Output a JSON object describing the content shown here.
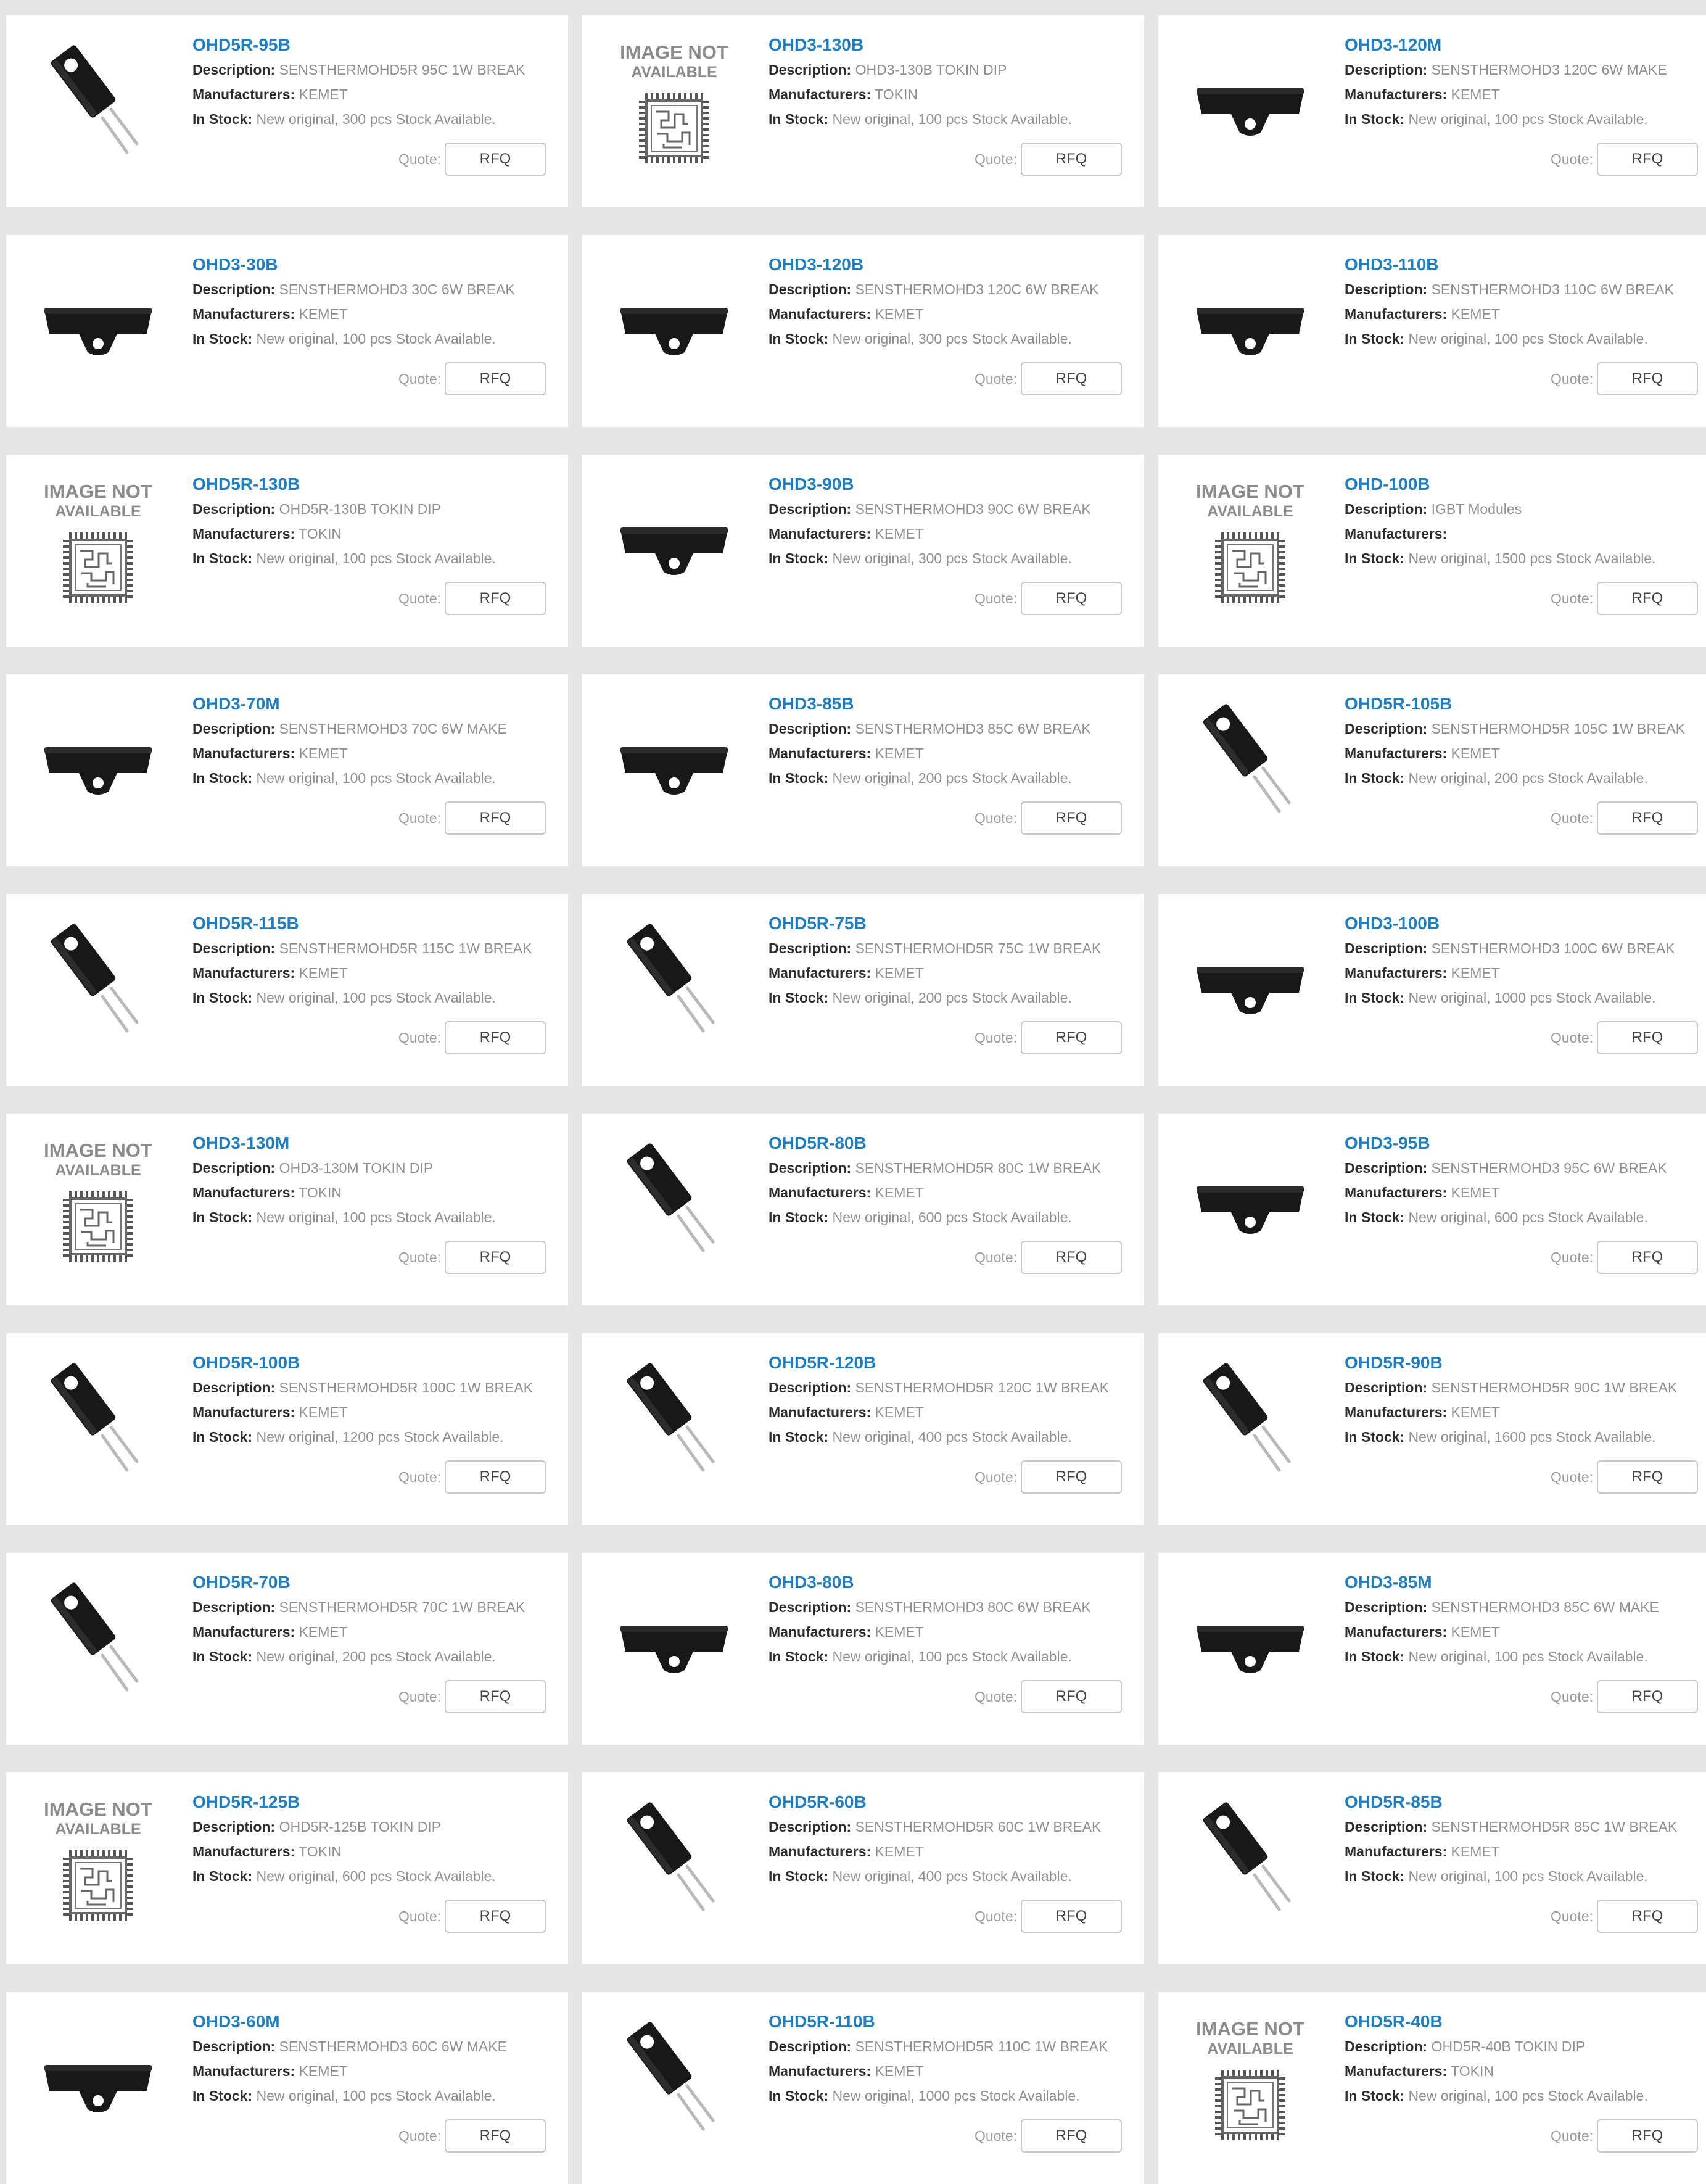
{
  "labels": {
    "description": "Description:",
    "manufacturers": "Manufacturers:",
    "in_stock": "In Stock:",
    "quote": "Quote:",
    "rfq": "RFQ",
    "na_line1": "IMAGE NOT",
    "na_line2": "AVAILABLE"
  },
  "products": [
    {
      "pn": "OHD5R-95B",
      "desc": "SENSTHERMOHD5R 95C 1W BREAK",
      "mfr": "KEMET",
      "stock": "New original, 300 pcs Stock Available.",
      "img": "tall"
    },
    {
      "pn": "OHD3-130B",
      "desc": "OHD3-130B TOKIN DIP",
      "mfr": "TOKIN",
      "stock": "New original, 100 pcs Stock Available.",
      "img": "na"
    },
    {
      "pn": "OHD3-120M",
      "desc": "SENSTHERMOHD3 120C 6W MAKE",
      "mfr": "KEMET",
      "stock": "New original, 100 pcs Stock Available.",
      "img": "flat"
    },
    {
      "pn": "OHD3-30B",
      "desc": "SENSTHERMOHD3 30C 6W BREAK",
      "mfr": "KEMET",
      "stock": "New original, 100 pcs Stock Available.",
      "img": "flat"
    },
    {
      "pn": "OHD3-120B",
      "desc": "SENSTHERMOHD3 120C 6W BREAK",
      "mfr": "KEMET",
      "stock": "New original, 300 pcs Stock Available.",
      "img": "flat"
    },
    {
      "pn": "OHD3-110B",
      "desc": "SENSTHERMOHD3 110C 6W BREAK",
      "mfr": "KEMET",
      "stock": "New original, 100 pcs Stock Available.",
      "img": "flat"
    },
    {
      "pn": "OHD5R-130B",
      "desc": "OHD5R-130B TOKIN DIP",
      "mfr": "TOKIN",
      "stock": "New original, 100 pcs Stock Available.",
      "img": "na"
    },
    {
      "pn": "OHD3-90B",
      "desc": "SENSTHERMOHD3 90C 6W BREAK",
      "mfr": "KEMET",
      "stock": "New original, 300 pcs Stock Available.",
      "img": "flat"
    },
    {
      "pn": "OHD-100B",
      "desc": "IGBT Modules",
      "mfr": "",
      "stock": "New original, 1500 pcs Stock Available.",
      "img": "na"
    },
    {
      "pn": "OHD3-70M",
      "desc": "SENSTHERMOHD3 70C 6W MAKE",
      "mfr": "KEMET",
      "stock": "New original, 100 pcs Stock Available.",
      "img": "flat"
    },
    {
      "pn": "OHD3-85B",
      "desc": "SENSTHERMOHD3 85C 6W BREAK",
      "mfr": "KEMET",
      "stock": "New original, 200 pcs Stock Available.",
      "img": "flat"
    },
    {
      "pn": "OHD5R-105B",
      "desc": "SENSTHERMOHD5R 105C 1W BREAK",
      "mfr": "KEMET",
      "stock": "New original, 200 pcs Stock Available.",
      "img": "tall"
    },
    {
      "pn": "OHD5R-115B",
      "desc": "SENSTHERMOHD5R 115C 1W BREAK",
      "mfr": "KEMET",
      "stock": "New original, 100 pcs Stock Available.",
      "img": "tall"
    },
    {
      "pn": "OHD5R-75B",
      "desc": "SENSTHERMOHD5R 75C 1W BREAK",
      "mfr": "KEMET",
      "stock": "New original, 200 pcs Stock Available.",
      "img": "tall"
    },
    {
      "pn": "OHD3-100B",
      "desc": "SENSTHERMOHD3 100C 6W BREAK",
      "mfr": "KEMET",
      "stock": "New original, 1000 pcs Stock Available.",
      "img": "flat"
    },
    {
      "pn": "OHD3-130M",
      "desc": "OHD3-130M TOKIN DIP",
      "mfr": "TOKIN",
      "stock": "New original, 100 pcs Stock Available.",
      "img": "na"
    },
    {
      "pn": "OHD5R-80B",
      "desc": "SENSTHERMOHD5R 80C 1W BREAK",
      "mfr": "KEMET",
      "stock": "New original, 600 pcs Stock Available.",
      "img": "tall"
    },
    {
      "pn": "OHD3-95B",
      "desc": "SENSTHERMOHD3 95C 6W BREAK",
      "mfr": "KEMET",
      "stock": "New original, 600 pcs Stock Available.",
      "img": "flat"
    },
    {
      "pn": "OHD5R-100B",
      "desc": "SENSTHERMOHD5R 100C 1W BREAK",
      "mfr": "KEMET",
      "stock": "New original, 1200 pcs Stock Available.",
      "img": "tall"
    },
    {
      "pn": "OHD5R-120B",
      "desc": "SENSTHERMOHD5R 120C 1W BREAK",
      "mfr": "KEMET",
      "stock": "New original, 400 pcs Stock Available.",
      "img": "tall"
    },
    {
      "pn": "OHD5R-90B",
      "desc": "SENSTHERMOHD5R 90C 1W BREAK",
      "mfr": "KEMET",
      "stock": "New original, 1600 pcs Stock Available.",
      "img": "tall"
    },
    {
      "pn": "OHD5R-70B",
      "desc": "SENSTHERMOHD5R 70C 1W BREAK",
      "mfr": "KEMET",
      "stock": "New original, 200 pcs Stock Available.",
      "img": "tall"
    },
    {
      "pn": "OHD3-80B",
      "desc": "SENSTHERMOHD3 80C 6W BREAK",
      "mfr": "KEMET",
      "stock": "New original, 100 pcs Stock Available.",
      "img": "flat"
    },
    {
      "pn": "OHD3-85M",
      "desc": "SENSTHERMOHD3 85C 6W MAKE",
      "mfr": "KEMET",
      "stock": "New original, 100 pcs Stock Available.",
      "img": "flat"
    },
    {
      "pn": "OHD5R-125B",
      "desc": "OHD5R-125B TOKIN DIP",
      "mfr": "TOKIN",
      "stock": "New original, 600 pcs Stock Available.",
      "img": "na"
    },
    {
      "pn": "OHD5R-60B",
      "desc": "SENSTHERMOHD5R 60C 1W BREAK",
      "mfr": "KEMET",
      "stock": "New original, 400 pcs Stock Available.",
      "img": "tall"
    },
    {
      "pn": "OHD5R-85B",
      "desc": "SENSTHERMOHD5R 85C 1W BREAK",
      "mfr": "KEMET",
      "stock": "New original, 100 pcs Stock Available.",
      "img": "tall"
    },
    {
      "pn": "OHD3-60M",
      "desc": "SENSTHERMOHD3 60C 6W MAKE",
      "mfr": "KEMET",
      "stock": "New original, 100 pcs Stock Available.",
      "img": "flat"
    },
    {
      "pn": "OHD5R-110B",
      "desc": "SENSTHERMOHD5R 110C 1W BREAK",
      "mfr": "KEMET",
      "stock": "New original, 1000 pcs Stock Available.",
      "img": "tall"
    },
    {
      "pn": "OHD5R-40B",
      "desc": "OHD5R-40B TOKIN DIP",
      "mfr": "TOKIN",
      "stock": "New original, 100 pcs Stock Available.",
      "img": "na"
    }
  ]
}
